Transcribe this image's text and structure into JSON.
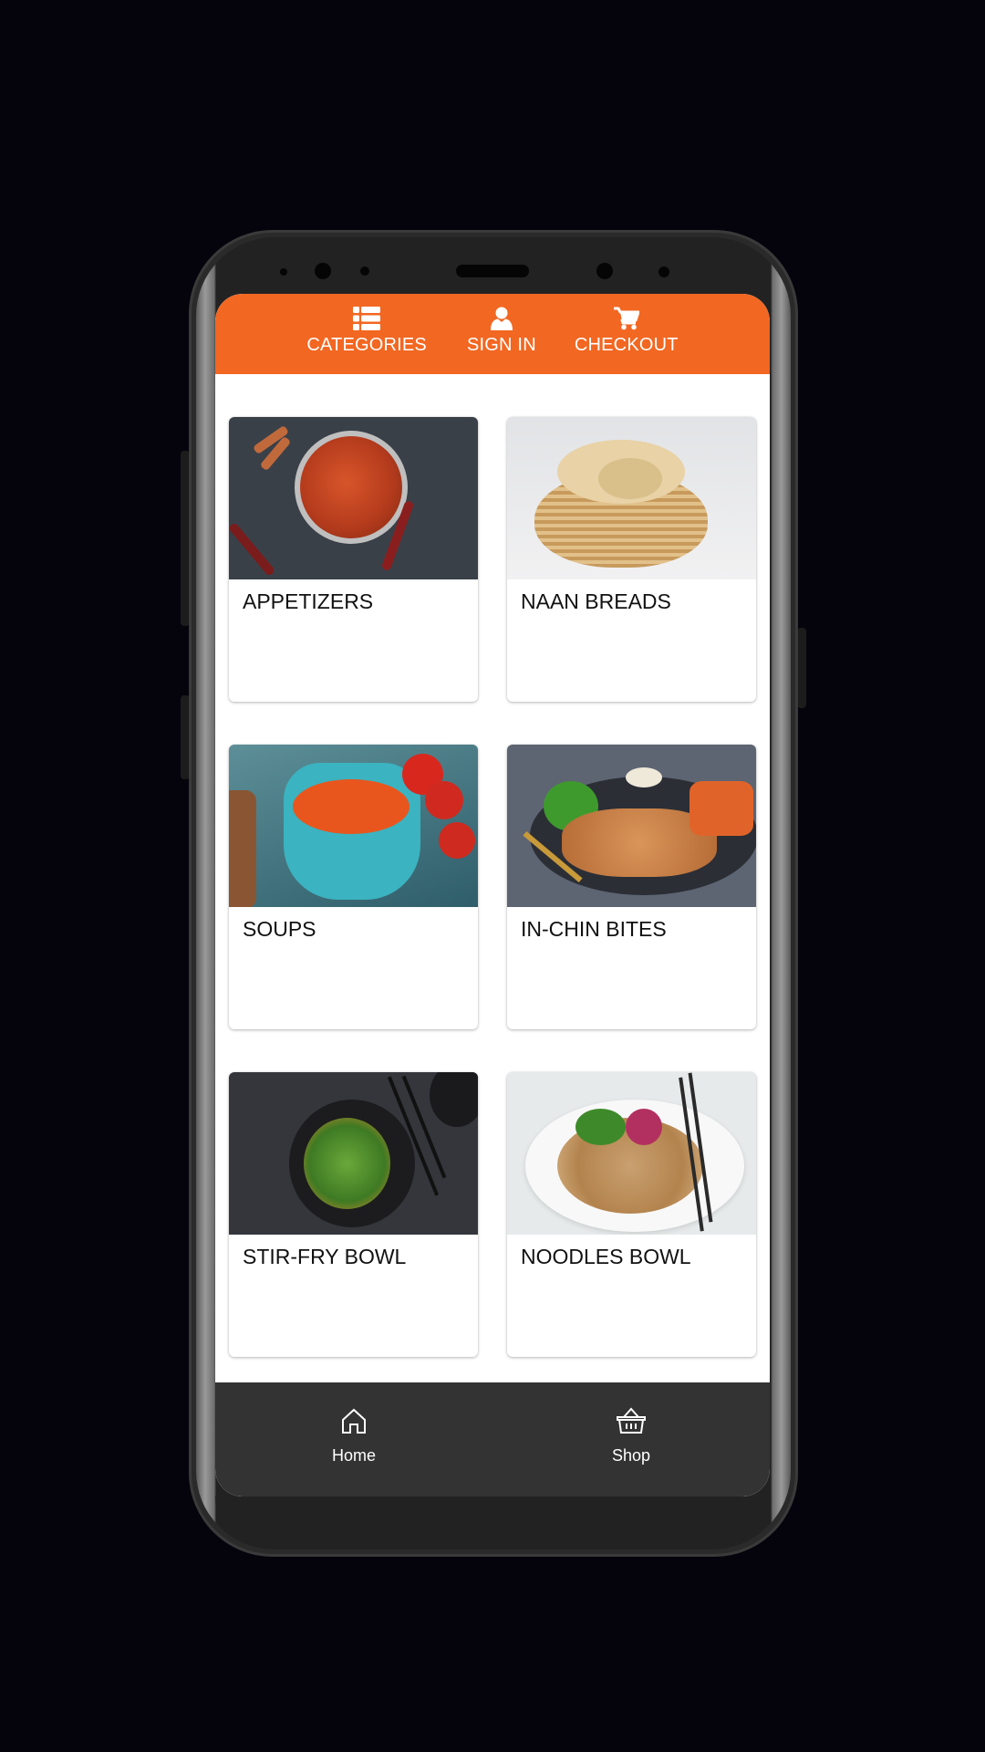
{
  "header": {
    "color": "#f26722",
    "items": [
      {
        "label": "CATEGORIES",
        "icon": "list-icon"
      },
      {
        "label": "SIGN IN",
        "icon": "user-icon"
      },
      {
        "label": "CHECKOUT",
        "icon": "cart-icon"
      }
    ]
  },
  "categories": [
    {
      "title": "APPETIZERS",
      "image": "appetizers-photo"
    },
    {
      "title": "NAAN BREADS",
      "image": "naan-breads-photo"
    },
    {
      "title": "SOUPS",
      "image": "soups-photo"
    },
    {
      "title": "IN-CHIN BITES",
      "image": "in-chin-bites-photo"
    },
    {
      "title": "STIR-FRY BOWL",
      "image": "stir-fry-bowl-photo"
    },
    {
      "title": "NOODLES BOWL",
      "image": "noodles-bowl-photo"
    }
  ],
  "bottom_nav": {
    "items": [
      {
        "label": "Home",
        "icon": "home-icon"
      },
      {
        "label": "Shop",
        "icon": "basket-icon"
      }
    ]
  }
}
